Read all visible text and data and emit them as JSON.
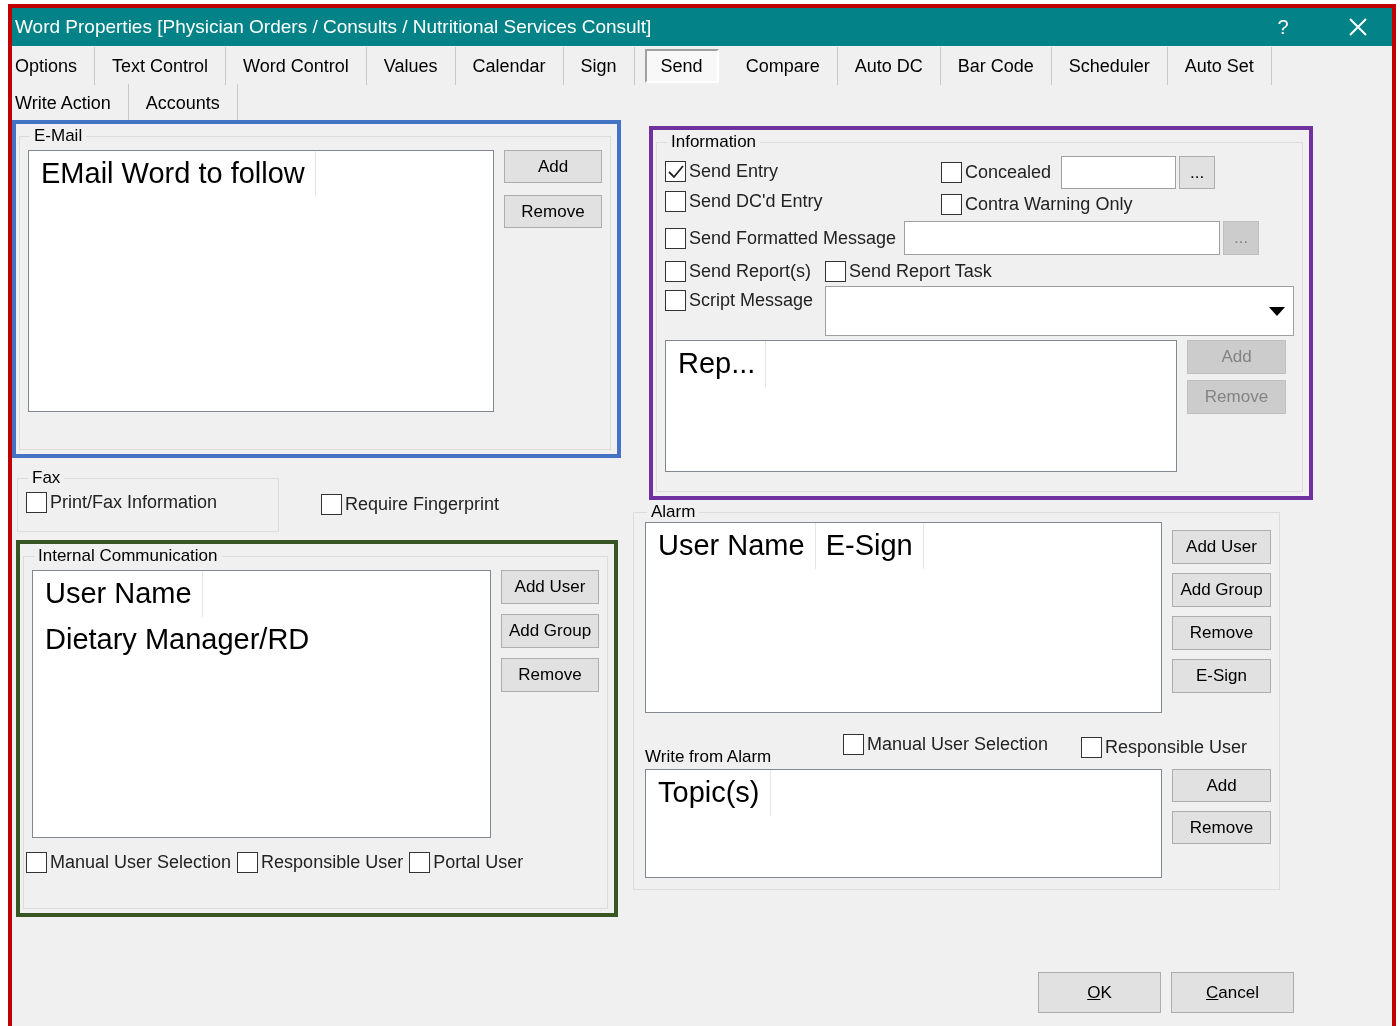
{
  "window": {
    "title": "Word Properties [Physician Orders / Consults / Nutritional Services Consult]",
    "help": "?"
  },
  "tab_rows": [
    [
      {
        "label": "Options",
        "selected": false
      },
      {
        "label": "Text Control",
        "selected": false
      },
      {
        "label": "Word Control",
        "selected": false
      },
      {
        "label": "Values",
        "selected": false
      },
      {
        "label": "Calendar",
        "selected": false
      },
      {
        "label": "Sign",
        "selected": false
      },
      {
        "label": "Send",
        "selected": true
      },
      {
        "label": "Compare",
        "selected": false
      },
      {
        "label": "Auto DC",
        "selected": false
      },
      {
        "label": "Bar Code",
        "selected": false
      },
      {
        "label": "Scheduler",
        "selected": false
      },
      {
        "label": "Auto Set",
        "selected": false
      }
    ],
    [
      {
        "label": "Write Action",
        "selected": false
      },
      {
        "label": "Accounts",
        "selected": false
      }
    ]
  ],
  "email": {
    "title": "E-Mail",
    "columns": [
      "EMail Word to follow"
    ],
    "buttons": [
      {
        "label": "Add",
        "disabled": false
      },
      {
        "label": "Remove",
        "disabled": false
      }
    ]
  },
  "fax": {
    "title": "Fax",
    "checkbox": {
      "label": "Print/Fax Information",
      "checked": false
    }
  },
  "require_fingerprint": {
    "label": "Require Fingerprint",
    "checked": false
  },
  "internal_communication": {
    "title": "Internal Communication",
    "columns": [
      "User Name"
    ],
    "rows": [
      "Dietary Manager/RD"
    ],
    "buttons": [
      {
        "label": "Add User",
        "disabled": false
      },
      {
        "label": "Add Group",
        "disabled": false
      },
      {
        "label": "Remove",
        "disabled": false
      }
    ],
    "checkboxes": [
      {
        "label": "Manual User Selection",
        "checked": false
      },
      {
        "label": "Responsible User",
        "checked": false
      },
      {
        "label": "Portal User",
        "checked": false
      }
    ]
  },
  "information": {
    "title": "Information",
    "checkboxes": [
      {
        "label": "Send Entry",
        "checked": true
      },
      {
        "label": "Concealed",
        "checked": false
      },
      {
        "label": "Send DC'd Entry",
        "checked": false
      },
      {
        "label": "Contra Warning Only",
        "checked": false
      },
      {
        "label": "Send Formatted Message",
        "checked": false
      },
      {
        "label": "Send Report(s)",
        "checked": false
      },
      {
        "label": "Send Report Task",
        "checked": false
      },
      {
        "label": "Script Message",
        "checked": false
      }
    ],
    "ellipsis_buttons": [
      {
        "label": "...",
        "disabled": false
      },
      {
        "label": "...",
        "disabled": true
      }
    ],
    "columns": [
      "Rep..."
    ],
    "buttons": [
      {
        "label": "Add",
        "disabled": true
      },
      {
        "label": "Remove",
        "disabled": true
      }
    ]
  },
  "alarm": {
    "title": "Alarm",
    "columns": [
      "User Name",
      "E-Sign"
    ],
    "buttons": [
      {
        "label": "Add User",
        "disabled": false
      },
      {
        "label": "Add Group",
        "disabled": false
      },
      {
        "label": "Remove",
        "disabled": false
      },
      {
        "label": "E-Sign",
        "disabled": false
      }
    ],
    "write_from_alarm": {
      "title": "Write from Alarm",
      "checkboxes": [
        {
          "label": "Manual User Selection",
          "checked": false
        },
        {
          "label": "Responsible User",
          "checked": false
        }
      ],
      "columns": [
        "Topic(s)"
      ],
      "buttons": [
        {
          "label": "Add",
          "disabled": false
        },
        {
          "label": "Remove",
          "disabled": false
        }
      ]
    }
  },
  "footer_buttons": [
    {
      "label": "OK"
    },
    {
      "label": "Cancel"
    }
  ]
}
